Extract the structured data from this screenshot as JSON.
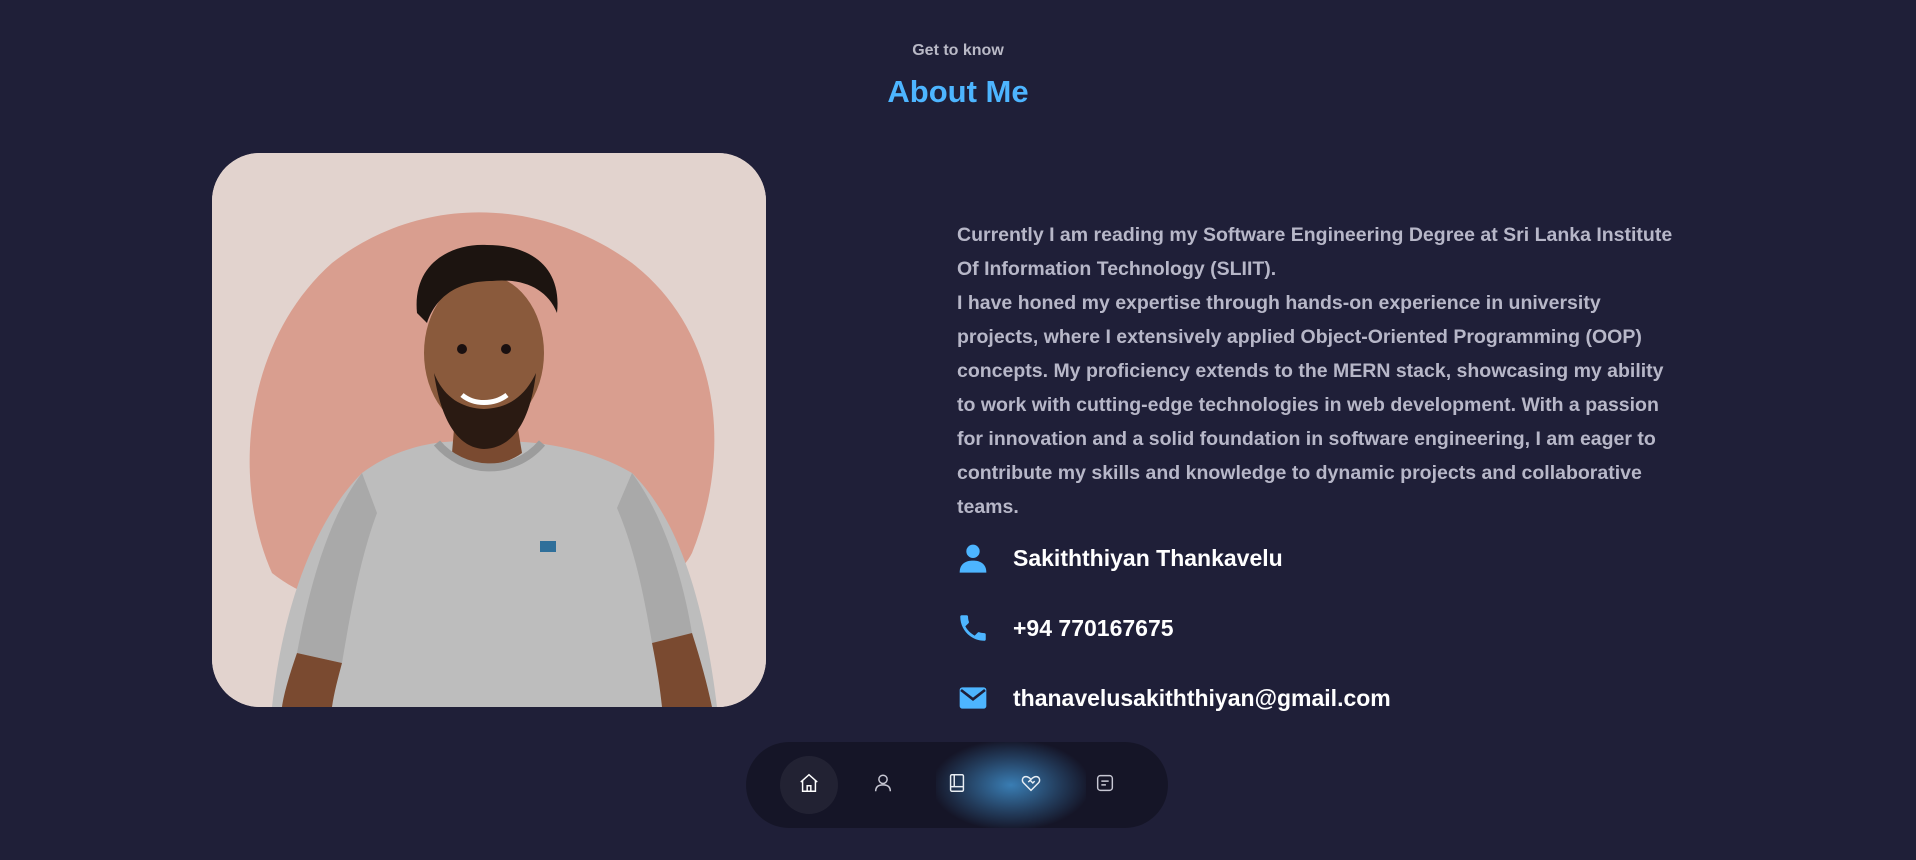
{
  "header": {
    "subtitle": "Get to know",
    "title": "About Me"
  },
  "about": {
    "paragraph_1": "Currently I am reading my Software Engineering Degree at Sri Lanka Institute Of Information Technology (SLIIT).",
    "paragraph_2": "I have honed my expertise through hands-on experience in university projects, where I extensively applied Object-Oriented Programming (OOP) concepts. My proficiency extends to the MERN stack, showcasing my ability to work with cutting-edge technologies in web development. With a passion for innovation and a solid foundation in software engineering, I am eager to contribute my skills and knowledge to dynamic projects and collaborative teams."
  },
  "contact": {
    "name": "Sakiththiyan Thankavelu",
    "phone": "+94 770167675",
    "email": "thanavelusakiththiyan@gmail.com"
  },
  "nav": {
    "items": [
      {
        "icon": "home-icon",
        "active": true
      },
      {
        "icon": "user-icon",
        "active": false
      },
      {
        "icon": "book-icon",
        "active": false
      },
      {
        "icon": "heart-handshake-icon",
        "active": false
      },
      {
        "icon": "message-icon",
        "active": false
      }
    ]
  },
  "colors": {
    "background": "#1f1f38",
    "accent": "#4db5ff",
    "text_muted": "#b7b7c8",
    "photo_bg": "#e2d3ce",
    "photo_blob": "#d99e8f"
  }
}
